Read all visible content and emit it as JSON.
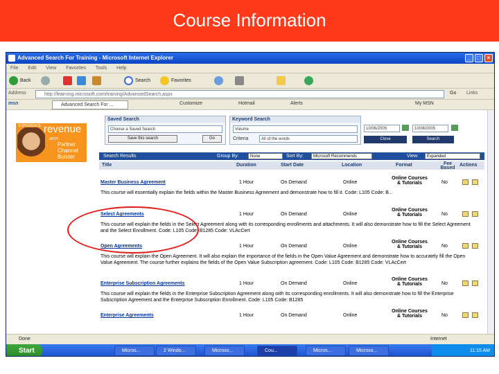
{
  "slide": {
    "title": "Course Information"
  },
  "window": {
    "title": "Advanced Search For Training - Microsoft Internet Explorer",
    "menu": [
      "File",
      "Edit",
      "View",
      "Favorites",
      "Tools",
      "Help"
    ],
    "toolbar": {
      "back": "Back",
      "search": "Search",
      "favorites": "Favorites"
    },
    "address_label": "Address",
    "address_value": "http://learning.microsoft.com/training/AdvancedSearch.aspx",
    "go": "Go",
    "links": "Links",
    "msn": "msn",
    "msn_items": [
      "Customize",
      "Hotmail",
      "Alerts",
      "My MSN"
    ],
    "tab_label": "Advanced Search For ..."
  },
  "promo": {
    "small": "EXPERIENCE",
    "brand": "revenue",
    "with": "WITH",
    "lines": [
      "Partner",
      "Channel",
      "Builder"
    ]
  },
  "saved_search": {
    "header": "Saved Search",
    "select_value": "Choose a Saved Search",
    "save_button": "Save this search",
    "go_button": "Go"
  },
  "keyword_search": {
    "header": "Keyword Search",
    "value": "Volume",
    "criteria_label": "Criteria",
    "criteria_value": "All of the words"
  },
  "date_range": {
    "from": "10/06/2005",
    "to": "10/06/2005",
    "close_button": "Close",
    "search_button": "Search"
  },
  "results": {
    "header": "Search Results",
    "group_by_label": "Group By:",
    "group_by_value": "None",
    "sort_by_label": "Sort By:",
    "sort_by_value": "Microsoft Recommends",
    "view_label": "View:",
    "view_value": "Expanded",
    "columns": [
      "Title",
      "Duration",
      "Start Date",
      "Location",
      "Format",
      "Fee Based",
      "Actions"
    ],
    "rows": [
      {
        "title": "Master Business Agreement",
        "duration": "1 Hour",
        "start": "On Demand",
        "location": "Online",
        "format": "Online Courses & Tutorials",
        "fee": "No",
        "desc": "This course will essentially explain the fields within the Master Business Agreement and demonstrate how to fill it. Code: L105 Code: B..."
      },
      {
        "title": "Select Agreements",
        "duration": "1 Hour",
        "start": "On Demand",
        "location": "Online",
        "format": "Online Courses & Tutorials",
        "fee": "No",
        "desc": "This course will explain the fields in the Select Agreement along with its corresponding enrollments and attachments. It will also demonstrate how to fill the Select Agreement and the Select Enrollment. Code: L105 Code: B1285 Code: VLAcCert"
      },
      {
        "title": "Open Agreements",
        "duration": "1 Hour",
        "start": "On Demand",
        "location": "Online",
        "format": "Online Courses & Tutorials",
        "fee": "No",
        "desc": "This course will explain the Open Agreement. It will also explain the importance of the fields in the Open Value Agreement and demonstrate how to accurately fill the Open Value Agreement. The course further explains the fields of the Open Value Subscription agreement. Code: L105 Code: B1285 Code: VLAcCert"
      },
      {
        "title": "Enterprise Subscription Agreements",
        "duration": "1 Hour",
        "start": "On Demand",
        "location": "Online",
        "format": "Online Courses & Tutorials",
        "fee": "No",
        "desc": "This course will explain the fields in the Enterprise Subscription Agreement along with its corresponding enrollments. It will also demonstrate how to fill the Enterprise Subscription Agreement and the Enterprise Subscription Enrollment. Code: L105 Code: B1285"
      },
      {
        "title": "Enterprise Agreements",
        "duration": "1 Hour",
        "start": "On Demand",
        "location": "Online",
        "format": "Online Courses & Tutorials",
        "fee": "No",
        "desc": ""
      }
    ]
  },
  "statusbar": {
    "left": "Done",
    "right": "Internet"
  },
  "taskbar": {
    "start": "Start",
    "tasks": [
      "Micros...",
      "2 Windo...",
      "Microso...",
      "Cou...",
      "Micros...",
      "Microso..."
    ],
    "tray": "11:15 AM"
  }
}
